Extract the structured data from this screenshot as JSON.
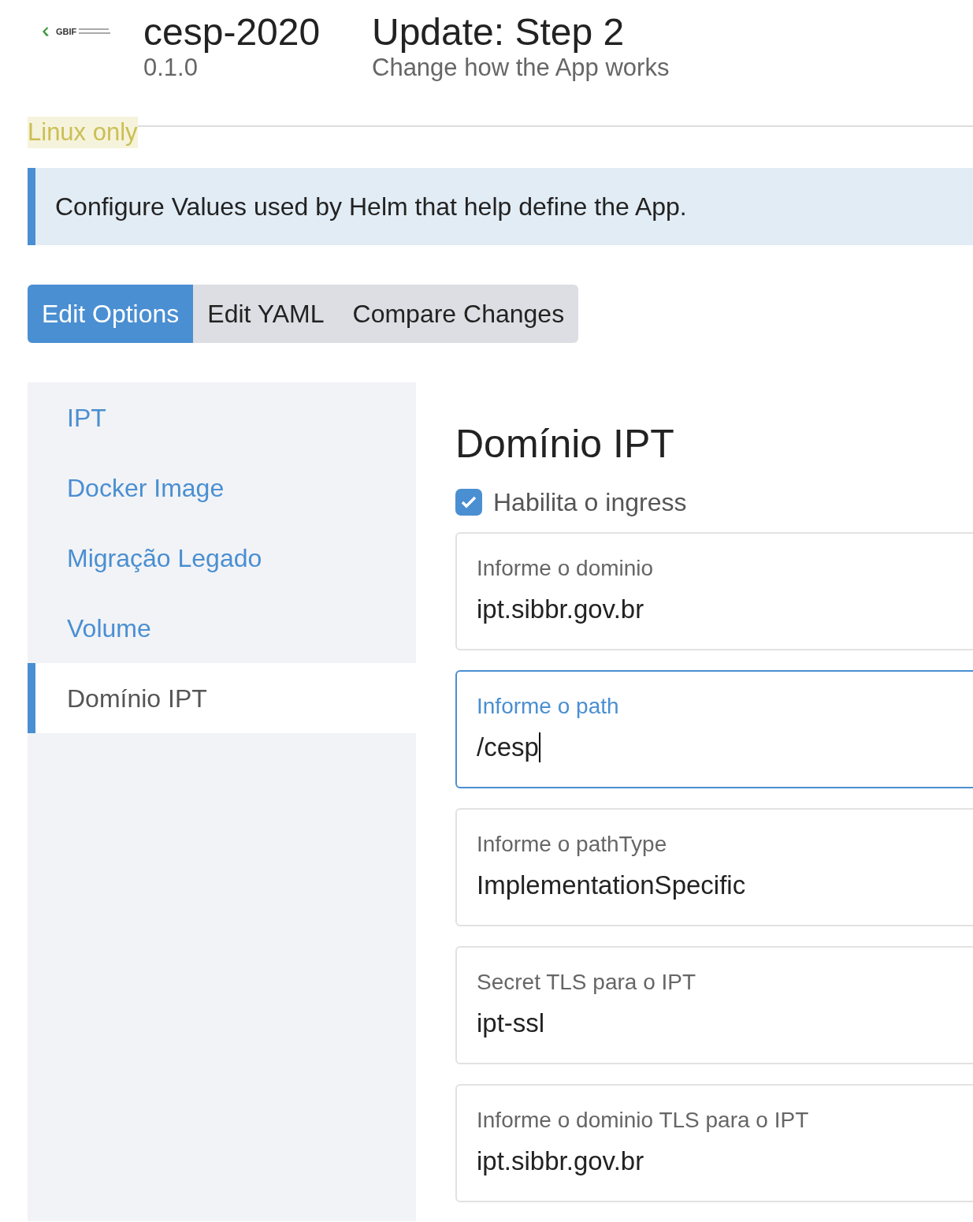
{
  "header": {
    "logo_text": "GBIF",
    "app_name": "cesp-2020",
    "version": "0.1.0",
    "title": "Update: Step 2",
    "subtitle": "Change how the App works"
  },
  "badge": "Linux only",
  "banner": "Configure Values used by Helm that help define the App.",
  "tabs": [
    {
      "label": "Edit Options",
      "selected": true
    },
    {
      "label": "Edit YAML",
      "selected": false
    },
    {
      "label": "Compare Changes",
      "selected": false
    }
  ],
  "sidebar": {
    "items": [
      {
        "label": "IPT",
        "selected": false
      },
      {
        "label": "Docker Image",
        "selected": false
      },
      {
        "label": "Migração Legado",
        "selected": false
      },
      {
        "label": "Volume",
        "selected": false
      },
      {
        "label": "Domínio IPT",
        "selected": true
      }
    ]
  },
  "section": {
    "title": "Domínio IPT",
    "checkbox": {
      "label": "Habilita o ingress",
      "checked": true
    },
    "fields": [
      {
        "label": "Informe o dominio",
        "value": "ipt.sibbr.gov.br",
        "focused": false
      },
      {
        "label": "Informe o path",
        "value": "/cesp",
        "focused": true
      },
      {
        "label": "Informe o pathType",
        "value": "ImplementationSpecific",
        "focused": false
      },
      {
        "label": "Secret TLS para o IPT",
        "value": "ipt-ssl",
        "focused": false
      },
      {
        "label": "Informe o dominio TLS para o IPT",
        "value": "ipt.sibbr.gov.br",
        "focused": false
      }
    ]
  }
}
